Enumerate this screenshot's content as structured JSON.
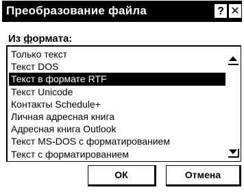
{
  "window": {
    "title": "Преобразование файла",
    "help_button": "?",
    "close_button": "✕"
  },
  "from_format": {
    "label_accel": "Из ",
    "label_underlined": "ф",
    "label_rest": "ормата:"
  },
  "list": {
    "selected_index": 2,
    "items": [
      "Только текст",
      "Текст DOS",
      "Текст в формате RTF",
      "Текст Unicode",
      "Контакты Schedule+",
      "Личная адресная книга",
      "Адресная книга Outlook",
      "Текст MS-DOS с форматированием",
      "Текст с форматированием"
    ]
  },
  "buttons": {
    "ok": "ОК",
    "cancel": "Отмена"
  }
}
